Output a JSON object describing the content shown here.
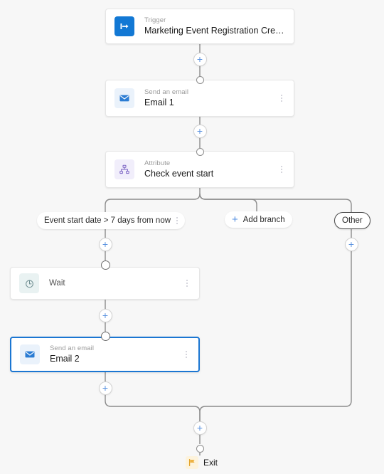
{
  "canvas": {
    "background": "#f7f7f7",
    "accent": "#1278d4",
    "selection_color": "#1b76d2",
    "wire_color": "#8c8c8c"
  },
  "nodes": [
    {
      "id": "trigger",
      "kind": "Trigger",
      "title": "Marketing Event Registration Created",
      "icon": "trigger-arrow-icon",
      "has_kebab": false,
      "selected": false
    },
    {
      "id": "email1",
      "kind": "Send an email",
      "title": "Email 1",
      "icon": "envelope-icon",
      "has_kebab": true,
      "selected": false
    },
    {
      "id": "attribute",
      "kind": "Attribute",
      "title": "Check event start",
      "icon": "hierarchy-icon",
      "has_kebab": true,
      "selected": false
    },
    {
      "id": "wait",
      "kind": "",
      "title": "Wait",
      "icon": "clock-icon",
      "has_kebab": true,
      "selected": false
    },
    {
      "id": "email2",
      "kind": "Send an email",
      "title": "Email 2",
      "icon": "envelope-icon",
      "has_kebab": true,
      "selected": true
    }
  ],
  "branches": [
    {
      "id": "condition",
      "label": "Event start date > 7 days from now",
      "style": "plain",
      "has_kebab": true
    },
    {
      "id": "add",
      "label": "Add branch",
      "style": "add",
      "has_kebab": false
    },
    {
      "id": "other",
      "label": "Other",
      "style": "outlined",
      "has_kebab": false
    }
  ],
  "add_buttons": [
    {
      "id": "add-after-trigger",
      "label": "+"
    },
    {
      "id": "add-after-email1",
      "label": "+"
    },
    {
      "id": "add-branch-left-top",
      "label": "+"
    },
    {
      "id": "add-after-wait",
      "label": "+"
    },
    {
      "id": "add-after-email2",
      "label": "+"
    },
    {
      "id": "add-branch-other",
      "label": "+"
    },
    {
      "id": "add-before-exit",
      "label": "+"
    }
  ],
  "exit": {
    "label": "Exit",
    "icon": "flag-icon"
  }
}
